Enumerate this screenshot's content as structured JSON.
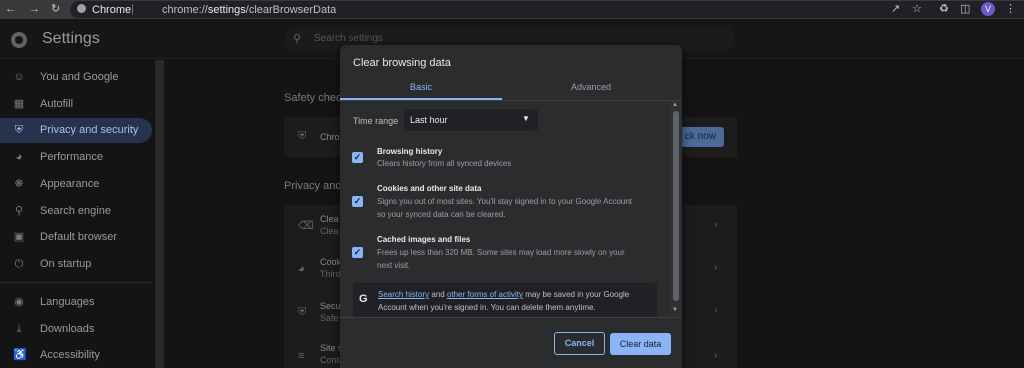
{
  "browser": {
    "url_host": "chrome://",
    "url_path": "settings",
    "url_rest": "/clearBrowserData",
    "site_label": "Chrome",
    "avatar_initial": "V"
  },
  "header": {
    "title": "Settings",
    "search_placeholder": "Search settings"
  },
  "sidebar": {
    "items": [
      {
        "label": "You and Google",
        "icon": "person-icon"
      },
      {
        "label": "Autofill",
        "icon": "autofill-icon"
      },
      {
        "label": "Privacy and security",
        "icon": "shield-icon",
        "active": true
      },
      {
        "label": "Performance",
        "icon": "speedometer-icon"
      },
      {
        "label": "Appearance",
        "icon": "palette-icon"
      },
      {
        "label": "Search engine",
        "icon": "search-icon"
      },
      {
        "label": "Default browser",
        "icon": "browser-icon"
      },
      {
        "label": "On startup",
        "icon": "power-icon"
      },
      {
        "label": "Languages",
        "icon": "globe-icon"
      },
      {
        "label": "Downloads",
        "icon": "download-icon"
      },
      {
        "label": "Accessibility",
        "icon": "accessibility-icon"
      }
    ]
  },
  "background": {
    "safety_title": "Safety check",
    "safety_row": "Chro",
    "check_now": "ck now",
    "privacy_title": "Privacy and s",
    "rows": [
      {
        "title": "Clea",
        "sub": "Clea"
      },
      {
        "title": "Cook",
        "sub": "Third"
      },
      {
        "title": "Secu",
        "sub": "Safe"
      },
      {
        "title": "Site s",
        "sub": "Contr"
      }
    ]
  },
  "dialog": {
    "title": "Clear browsing data",
    "tabs": [
      "Basic",
      "Advanced"
    ],
    "time_range_label": "Time range",
    "time_range_value": "Last hour",
    "options": [
      {
        "title": "Browsing history",
        "desc1": "Clears history from all synced devices",
        "desc2": "",
        "checked": true
      },
      {
        "title": "Cookies and other site data",
        "desc1": "Signs you out of most sites. You'll stay signed in to your Google Account",
        "desc2": "so your synced data can be cleared.",
        "checked": true
      },
      {
        "title": "Cached images and files",
        "desc1": "Frees up less than 320 MB. Some sites may load more slowly on your",
        "desc2": "next visit.",
        "checked": true
      }
    ],
    "google_note": {
      "link1": "Search history",
      "mid": " and ",
      "link2": "other forms of activity",
      "rest1": " may be saved in your Google",
      "line2": "Account when you're signed in. You can delete them anytime."
    },
    "cancel_label": "Cancel",
    "clear_label": "Clear data"
  },
  "colors": {
    "accent": "#8ab4f8",
    "dialog_bg": "#2b2c2e",
    "page_bg": "#141414"
  }
}
